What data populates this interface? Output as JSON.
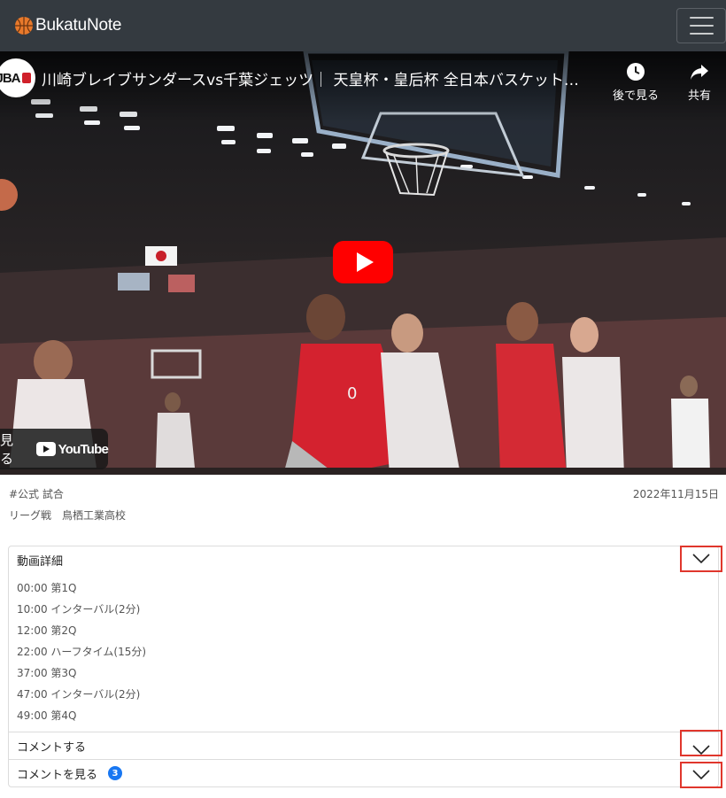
{
  "app": {
    "brand": "BukatuNote",
    "brand_icon": "basketball-icon",
    "menu_icon": "hamburger-menu-icon"
  },
  "video": {
    "title": "川崎ブレイブサンダースvs千葉ジェッツ｜ 天皇杯・皇后杯 全日本バスケット…",
    "channel_logo_text": "JBA",
    "watch_later_label": "後で見る",
    "share_label": "共有",
    "watch_on_label": "見る",
    "youtube_label": "YouTube",
    "play_icon": "play-icon"
  },
  "meta": {
    "tags": "#公式 試合",
    "date": "2022年11月15日",
    "game_info": "リーグ戦　鳥栖工業高校"
  },
  "accordion": {
    "details_label": "動画詳細",
    "chapters": [
      {
        "text": "00:00 第1Q"
      },
      {
        "text": "10:00 インターバル(2分)"
      },
      {
        "text": "12:00 第2Q"
      },
      {
        "text": "22:00 ハーフタイム(15分)"
      },
      {
        "text": "37:00 第3Q"
      },
      {
        "text": "47:00 インターバル(2分)"
      },
      {
        "text": "49:00 第4Q"
      }
    ],
    "comment_label": "コメントする",
    "view_comments_label": "コメントを見る",
    "comment_count": "3"
  },
  "colors": {
    "navbar": "#343a40",
    "highlight_box": "#e0362c",
    "badge": "#1877f2",
    "youtube_red": "#ff0000"
  }
}
